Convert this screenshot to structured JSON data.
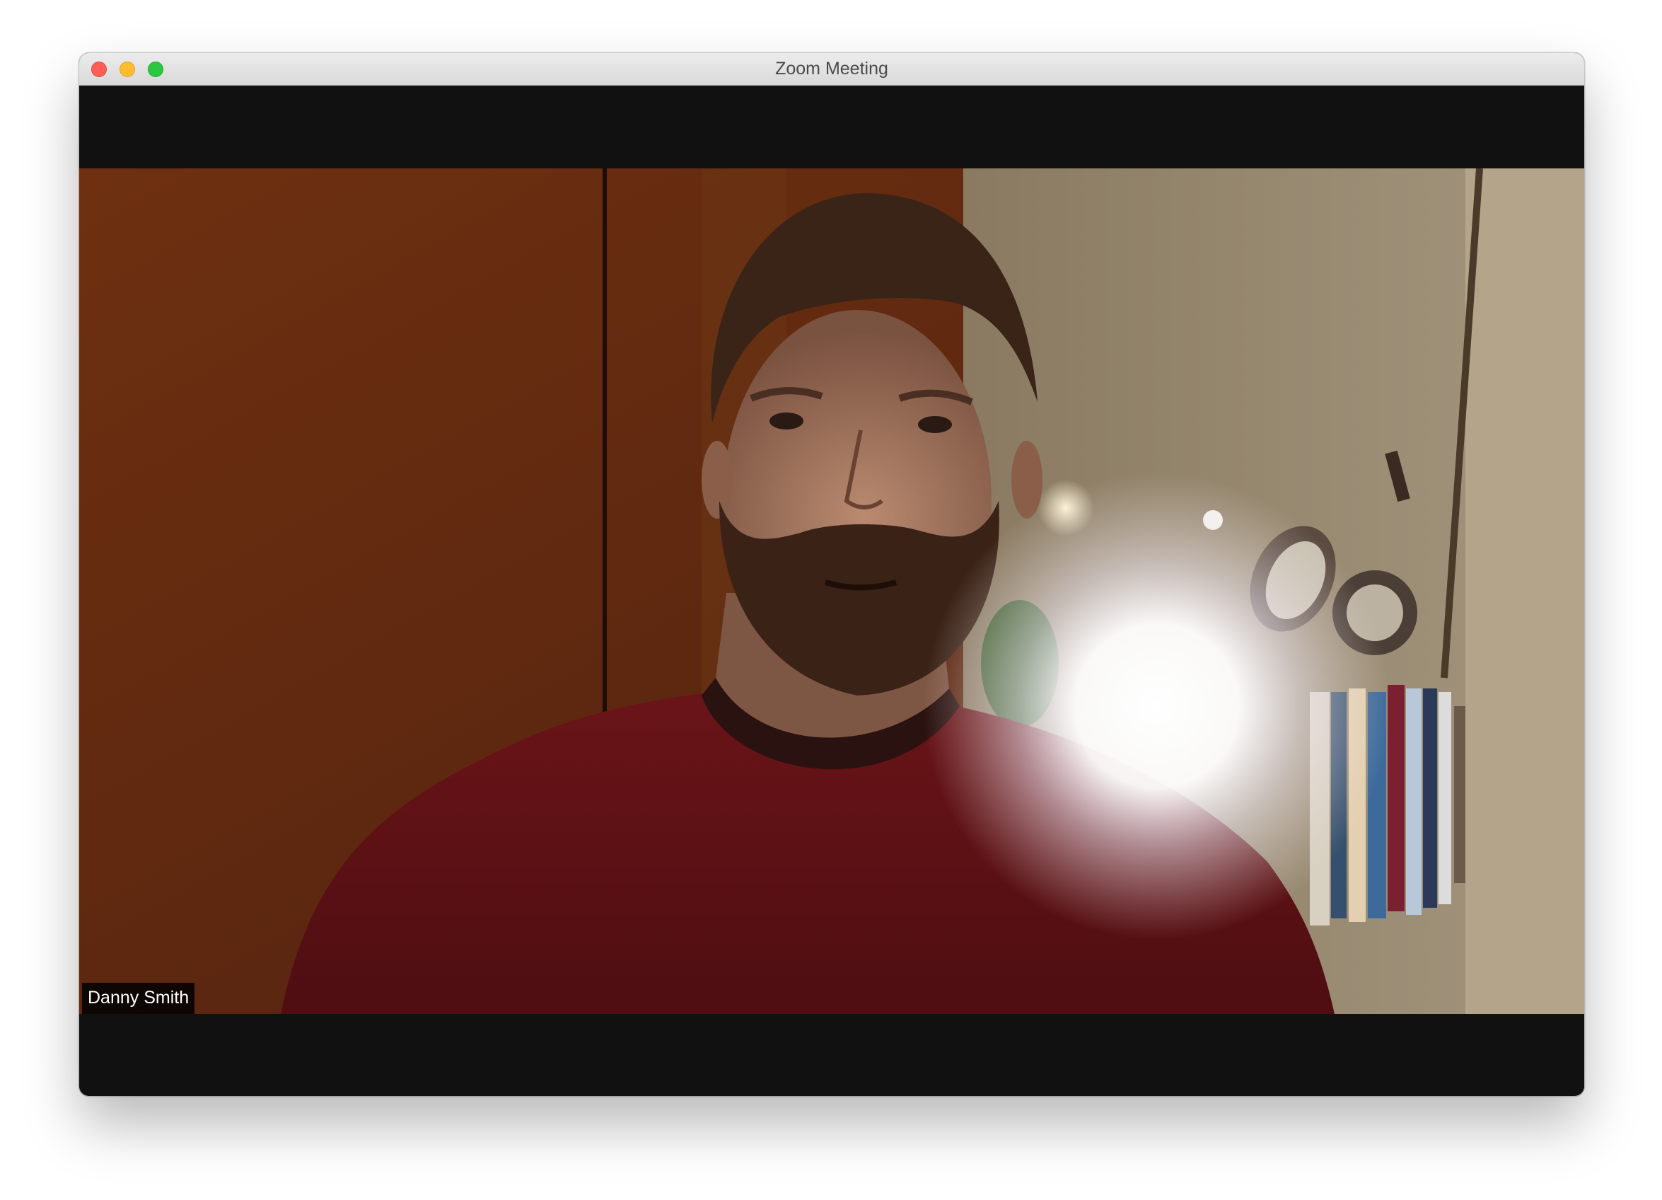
{
  "window": {
    "title": "Zoom Meeting"
  },
  "participant": {
    "name": "Danny Smith"
  }
}
